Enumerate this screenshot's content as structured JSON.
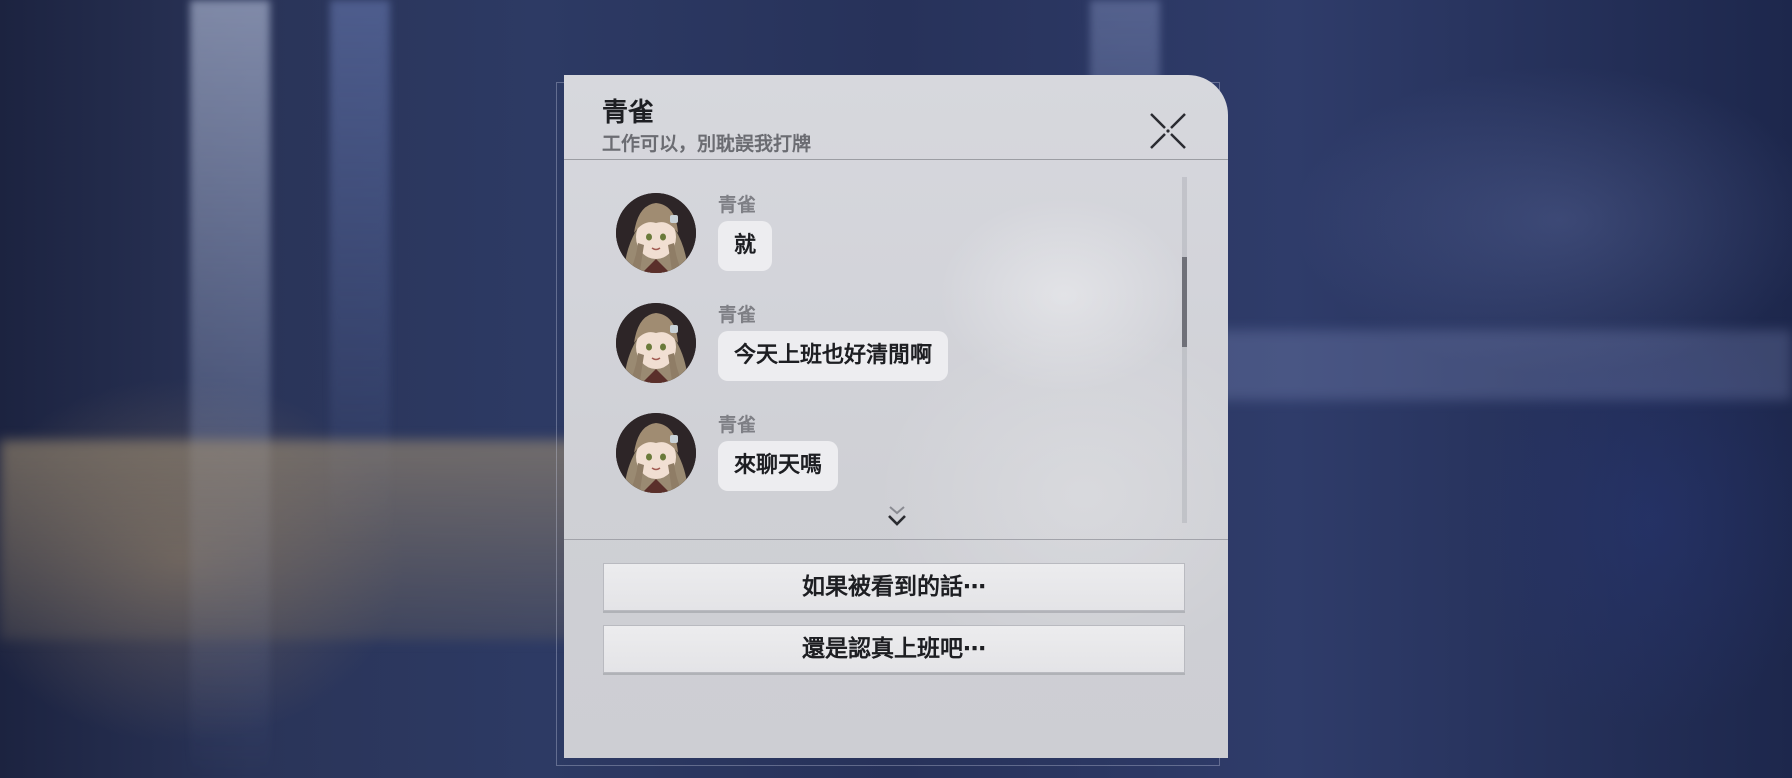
{
  "chat": {
    "title": "青雀",
    "subtitle": "工作可以，別耽誤我打牌",
    "messages": [
      {
        "sender": "青雀",
        "text": "就"
      },
      {
        "sender": "青雀",
        "text": "今天上班也好清閒啊"
      },
      {
        "sender": "青雀",
        "text": "來聊天嗎"
      }
    ]
  },
  "options": [
    {
      "label": "如果被看到的話⋯"
    },
    {
      "label": "還是認真上班吧⋯"
    }
  ],
  "icons": {
    "close": "close-icon",
    "more": "chevron-down-double-icon",
    "avatar": "qingque-avatar"
  }
}
